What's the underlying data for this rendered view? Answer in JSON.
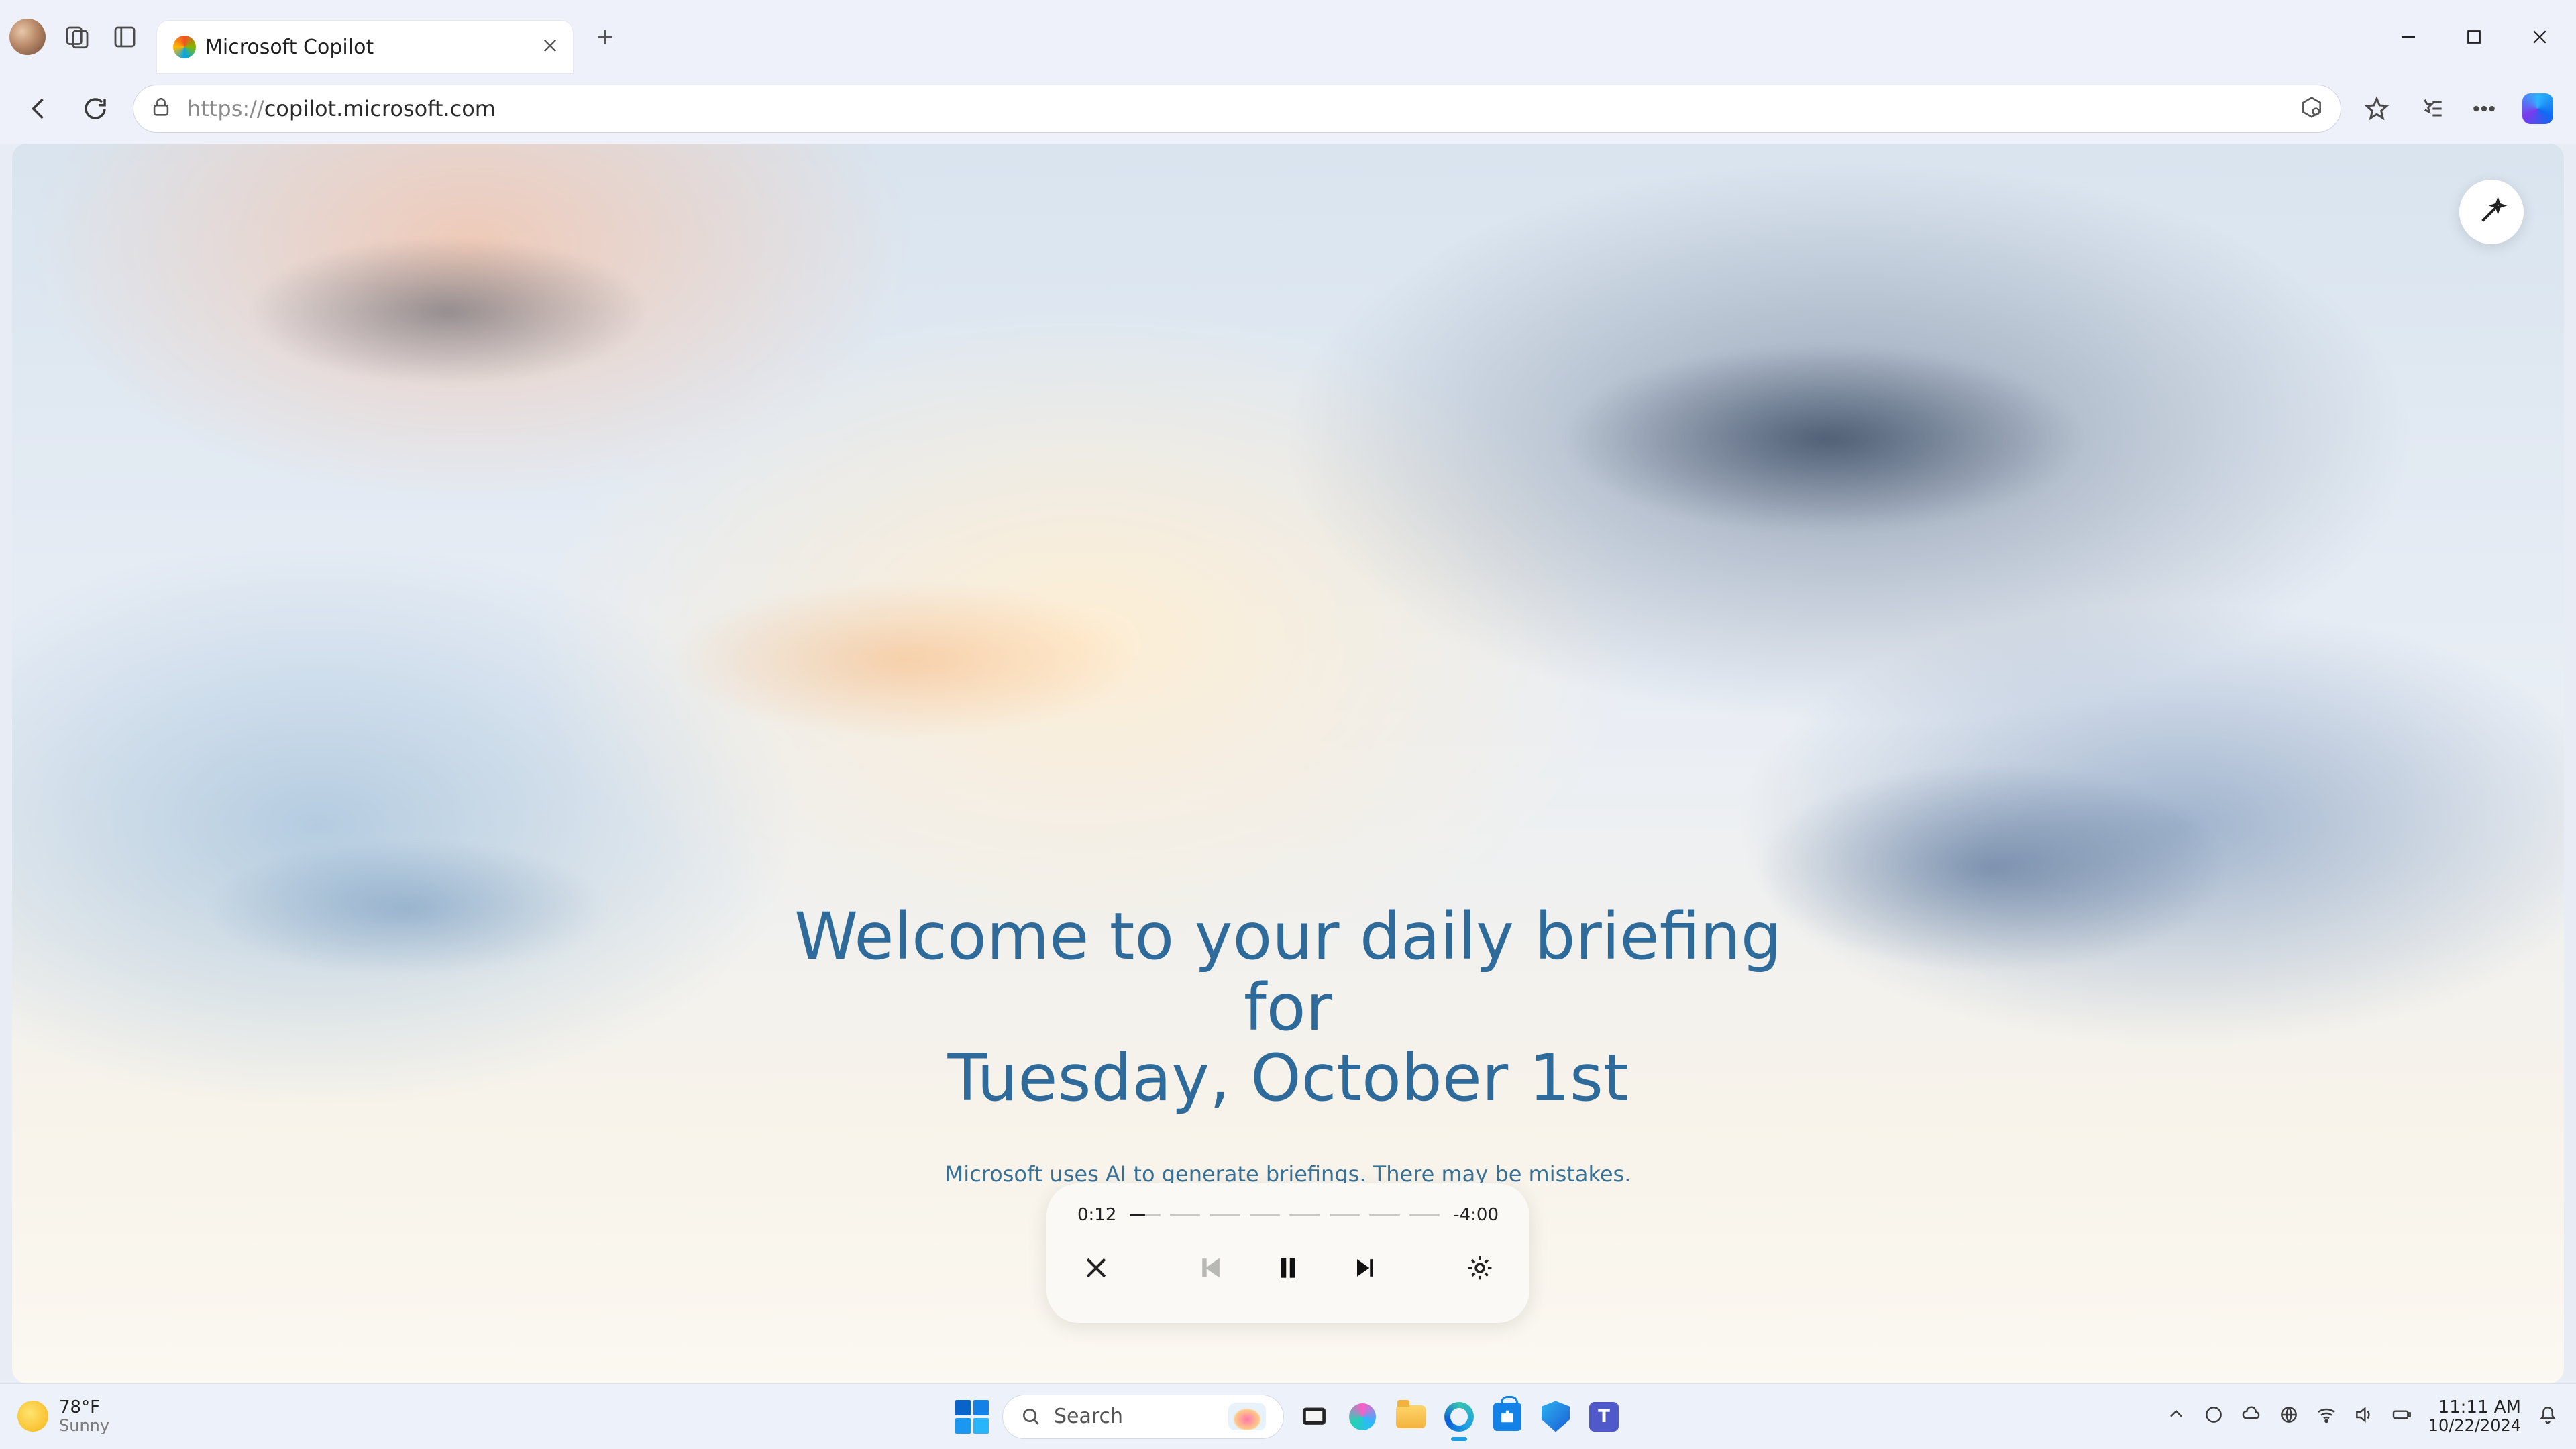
{
  "browser": {
    "tab_title": "Microsoft Copilot",
    "url_scheme": "https://",
    "url_rest": "copilot.microsoft.com"
  },
  "page": {
    "headline_l1": "Welcome to your daily briefing for",
    "headline_l2": "Tuesday, October 1st",
    "disclaimer": "Microsoft uses AI to generate briefings. There may be mistakes."
  },
  "player": {
    "elapsed": "0:12",
    "remaining": "-4:00",
    "progress_pct": 5,
    "segments": 8
  },
  "taskbar": {
    "weather_temp": "78°F",
    "weather_cond": "Sunny",
    "search_placeholder": "Search",
    "time": "11:11 AM",
    "date": "10/22/2024"
  }
}
